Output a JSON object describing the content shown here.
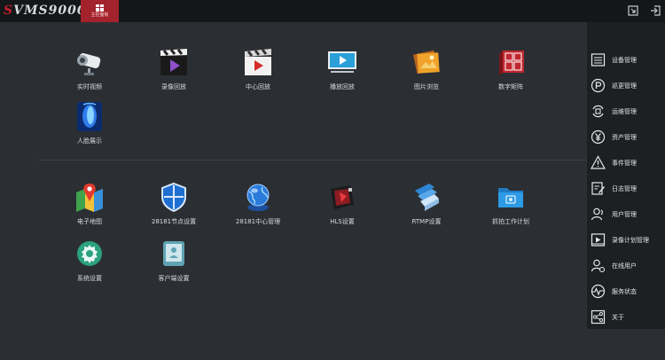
{
  "app": {
    "logo_text": "VMS9000",
    "logo_prefix": "S",
    "home_label": "主控面板"
  },
  "colors": {
    "brand_red": "#a3222c",
    "topbar": "#141618",
    "background": "#2b2f33",
    "sidebar": "#1d2023"
  },
  "main": {
    "row1": [
      {
        "label": "实时视频",
        "icon": "camera-icon"
      },
      {
        "label": "录像回放",
        "icon": "clapperboard-play-icon"
      },
      {
        "label": "中心回放",
        "icon": "clapperboard-center-icon"
      },
      {
        "label": "播放回放",
        "icon": "monitor-play-icon"
      },
      {
        "label": "图片浏览",
        "icon": "photos-icon"
      },
      {
        "label": "数字矩阵",
        "icon": "matrix-cube-icon"
      },
      {
        "label": "人脸展示",
        "icon": "face-icon"
      }
    ],
    "row2": [
      {
        "label": "电子地图",
        "icon": "map-pin-icon"
      },
      {
        "label": "28181节点设置",
        "icon": "shield-icon"
      },
      {
        "label": "28181中心管理",
        "icon": "globe-icon"
      },
      {
        "label": "HLS设置",
        "icon": "hls-box-icon"
      },
      {
        "label": "RTMP设置",
        "icon": "rtmp-stack-icon"
      },
      {
        "label": "抓拍工作计划",
        "icon": "folder-icon"
      },
      {
        "label": "系统设置",
        "icon": "settings-gear-icon"
      },
      {
        "label": "客户端设置",
        "icon": "client-phone-icon"
      }
    ]
  },
  "sidebar": {
    "items": [
      {
        "label": "设备管理",
        "icon": "device-list-icon"
      },
      {
        "label": "巡更管理",
        "icon": "patrol-p-icon"
      },
      {
        "label": "运维管理",
        "icon": "maintenance-icon"
      },
      {
        "label": "资产管理",
        "icon": "yen-icon"
      },
      {
        "label": "事件管理",
        "icon": "warning-icon"
      },
      {
        "label": "日志管理",
        "icon": "log-edit-icon"
      },
      {
        "label": "用户管理",
        "icon": "user-manage-icon"
      },
      {
        "label": "录像计划管理",
        "icon": "record-plan-icon"
      },
      {
        "label": "在线用户",
        "icon": "online-user-icon"
      },
      {
        "label": "服务状态",
        "icon": "service-status-icon"
      },
      {
        "label": "关于",
        "icon": "share-about-icon"
      }
    ]
  }
}
